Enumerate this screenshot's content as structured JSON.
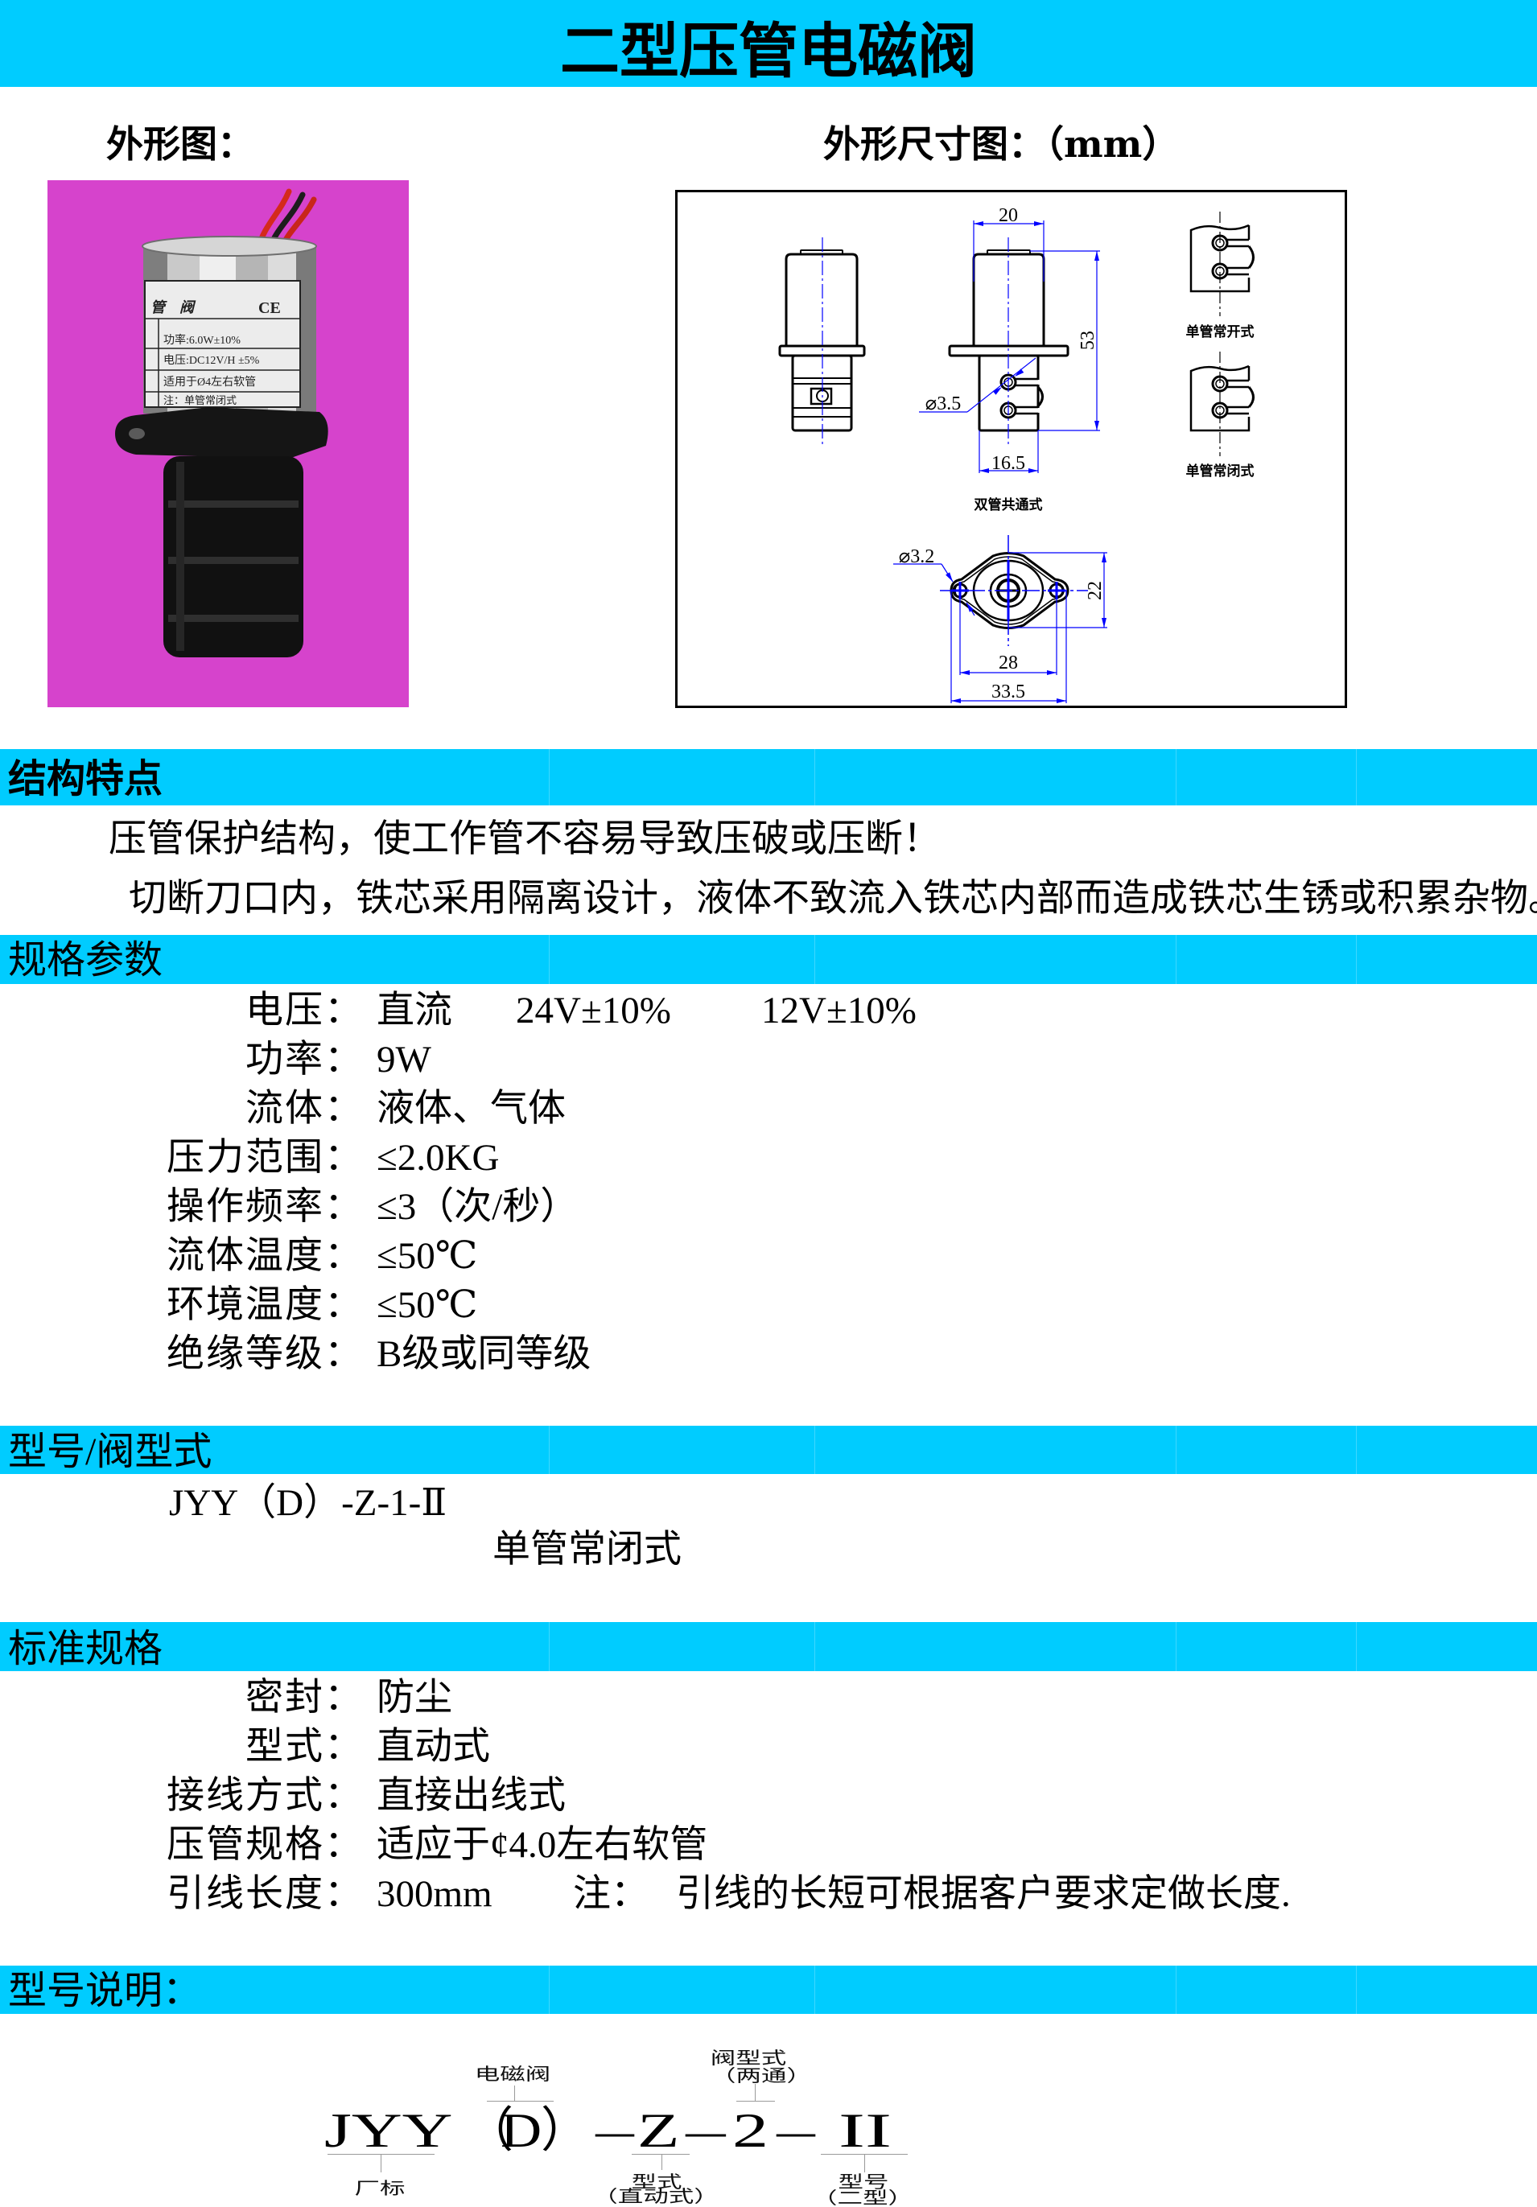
{
  "document": {
    "title": "二型压管电磁阀",
    "accent_color": "#00CCFF"
  },
  "overview": {
    "photo_heading": "外形图：",
    "dimension_heading": "外形尺寸图：（mm）",
    "photo": {
      "background_color": "#D643CC",
      "label": {
        "title": "管　阀",
        "mark": "CE",
        "lines": [
          "功率:6.0W±10%",
          "电压:DC12V/H ±5%",
          "适用于Ø4左右软管",
          "注：单管常闭式"
        ]
      }
    },
    "drawing": {
      "line_color": "#0000FF",
      "dims": {
        "top_width": "20",
        "height": "53",
        "slot_hole": "⌀3.5",
        "base_width": "16.5",
        "flange_height": "22",
        "hole_spacing": "28",
        "flange_width": "33.5",
        "mount_hole": "⌀3.2"
      },
      "captions": {
        "double": "双管共通式",
        "single_open": "单管常开式",
        "single_closed": "单管常闭式"
      }
    }
  },
  "sections": {
    "features": {
      "heading": "结构特点",
      "lines": [
        "压管保护结构，使工作管不容易导致压破或压断！",
        "切断刀口内，铁芯采用隔离设计，液体不致流入铁芯内部而造成铁芯生锈或积累杂物。"
      ]
    },
    "specs": {
      "heading": "规格参数",
      "rows": [
        {
          "label": "电压：",
          "value": "直流",
          "extra": [
            "24V±10%",
            "12V±10%"
          ]
        },
        {
          "label": "功率：",
          "value": "9W"
        },
        {
          "label": "流体：",
          "value": "液体、气体"
        },
        {
          "label": "压力范围：",
          "value": "≤2.0KG"
        },
        {
          "label": "操作频率：",
          "value": "≤3（次/秒）"
        },
        {
          "label": "流体温度：",
          "value": "≤50℃"
        },
        {
          "label": "环境温度：",
          "value": "≤50℃"
        },
        {
          "label": "绝缘等级：",
          "value": "B级或同等级"
        }
      ]
    },
    "model": {
      "heading": "型号/阀型式",
      "code": "JYY（D）-Z-1-Ⅱ",
      "type": "单管常闭式"
    },
    "standard": {
      "heading": "标准规格",
      "rows": [
        {
          "label": "密封：",
          "value": "防尘"
        },
        {
          "label": "型式：",
          "value": "直动式"
        },
        {
          "label": "接线方式：",
          "value": "直接出线式"
        },
        {
          "label": "压管规格：",
          "value": "适应于¢4.0左右软管"
        },
        {
          "label": "引线长度：",
          "value": "300mm",
          "note_label": "注：",
          "note": "引线的长短可根据客户要求定做长度."
        }
      ]
    },
    "model_explain": {
      "heading": "型号说明：",
      "tokens": [
        "JYY",
        "（",
        "D",
        "）",
        "—",
        "Z",
        "—",
        "2",
        "—",
        "II"
      ],
      "annotations": {
        "brand": "厂标",
        "solenoid": "电磁阀",
        "valve_type": "阀型式",
        "valve_type_note": "（两通）",
        "style": "型式",
        "style_note": "（直动式）",
        "model_no": "型号",
        "model_no_note": "（二型）"
      }
    }
  }
}
